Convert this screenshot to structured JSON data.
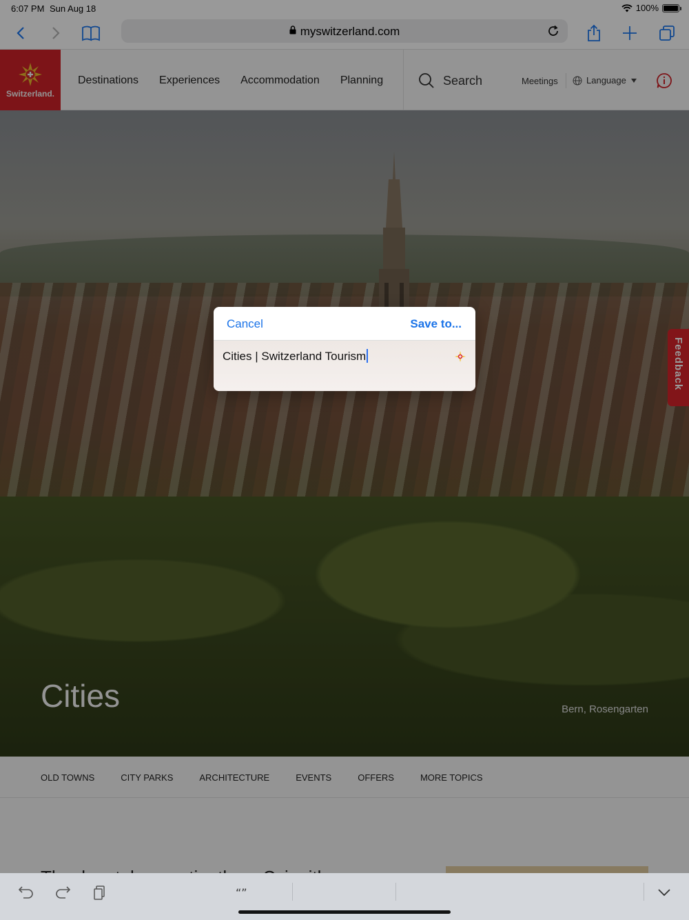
{
  "status": {
    "time": "6:07 PM",
    "date": "Sun Aug 18",
    "battery": "100%",
    "battery_level": 1.0
  },
  "browser": {
    "url": "myswitzerland.com"
  },
  "site": {
    "logo_text": "Switzerland.",
    "nav": [
      "Destinations",
      "Experiences",
      "Accommodation",
      "Planning"
    ],
    "search_label": "Search",
    "meetings": "Meetings",
    "language": "Language"
  },
  "hero": {
    "title": "Cities",
    "caption": "Bern, Rosengarten",
    "feedback": "Feedback"
  },
  "topics": [
    "OLD TOWNS",
    "CITY PARKS",
    "ARCHITECTURE",
    "EVENTS",
    "OFFERS",
    "MORE TOPICS"
  ],
  "content": {
    "teaser": "Th... l... ..t..l ... ... ..ti ...th.. .. Cvi. ..itl.."
  },
  "dialog": {
    "cancel": "Cancel",
    "save_to": "Save to...",
    "title_value": "Cities | Switzerland Tourism"
  },
  "keyboard_bar": {
    "quotes": "“”"
  },
  "colors": {
    "brand_red": "#d8232a",
    "ios_blue": "#1a73e8"
  }
}
